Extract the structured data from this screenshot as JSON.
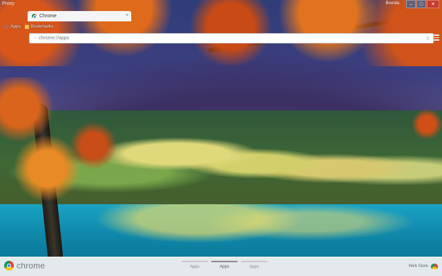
{
  "window": {
    "profile_label": "Proxy",
    "user_label": "Brenda",
    "controls": {
      "minimize": "–",
      "maximize": "□",
      "close": "✕"
    }
  },
  "tab": {
    "title": "Chrome",
    "close_symbol": "×",
    "favicon": "chrome-favicon-icon"
  },
  "omnibox": {
    "url": "chrome://apps",
    "star_symbol": "☆",
    "page_symbol": "▫"
  },
  "bookmarks": {
    "items": [
      {
        "label": "Apps",
        "icon": "apps-grid-icon"
      },
      {
        "label": "Bookmarks",
        "icon": "folder-icon"
      }
    ]
  },
  "bottom_bar": {
    "brand_text": "chrome",
    "pages": [
      {
        "label": "Apps",
        "active": false
      },
      {
        "label": "Apps",
        "active": true
      },
      {
        "label": "Apps",
        "active": false
      }
    ],
    "web_store_label": "Web Store"
  },
  "colors": {
    "bottom_bar_bg": "#eceef0",
    "omnibox_bg": "#ffffff",
    "close_button": "#c8392b"
  }
}
